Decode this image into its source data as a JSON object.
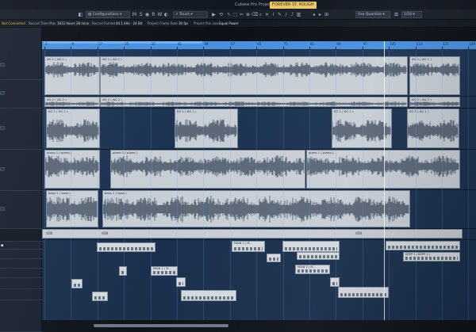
{
  "window": {
    "title": "Cubase Pro Project",
    "project_name": "FOREVER ST. ROUGH"
  },
  "toolbar": {
    "configurations_label": "Configurations",
    "touch_label": "Touch",
    "grid_label": "Use Quantize",
    "quantize_label": "1/16"
  },
  "status": {
    "midi_label": "Not Connected",
    "record_time_label": "Record Time Max",
    "record_time_value": "1612 hours 28 mins",
    "record_format_label": "Record Format",
    "record_format_value": "44.1 kHz - 24 Bit",
    "frame_rate_label": "Project Frame Rate",
    "frame_rate_value": "30 fps",
    "pan_law_label": "Project Pan Law",
    "pan_law_value": "Equal Power"
  },
  "ruler": {
    "bars": [
      "1",
      "9",
      "17",
      "25",
      "33",
      "41",
      "49",
      "57",
      "65",
      "73",
      "81",
      "89",
      "97",
      "105",
      "113",
      "121",
      "129"
    ]
  },
  "events": {
    "ag1_a": "AG 1 ( AG 1 )",
    "ag1_b": "AG 1 ( AG 1 )",
    "ag1_c": "AG 1 ( AG 1 )",
    "ag2_a": "AG 2 ( AG 2 )",
    "ag2_b": "AG 2 ( AG 2 )",
    "ag2_c": "AG 2 ( AG 2 )",
    "eg1_a": "EG 1 ( EG 1 )",
    "eg1_b": "EG 1 ( EG 1 )",
    "eg1_c": "EG 1 ( EG 1 )",
    "eg1_d": "EG 1 ( EG 1 )",
    "piano1_a": "piano 1 ( piano )",
    "piano1_b": "piano 1 ( piano )",
    "piano1_c": "piano 1 ( piano )",
    "bass1_a": "bass 1 ( bass )",
    "bass1_b": "bass 1 ( bass )"
  },
  "parts": {
    "vox_a": "VOX",
    "vox_b": "VOX",
    "vox_c": "VOX"
  },
  "midi": {
    "main_a": "MAIN 1 ( M...",
    "main_b": "MAIN 1 ( M...",
    "main_c": "MAIN 2 ( M...",
    "keep": "KEEP 1 ( KEEP 1 )"
  }
}
